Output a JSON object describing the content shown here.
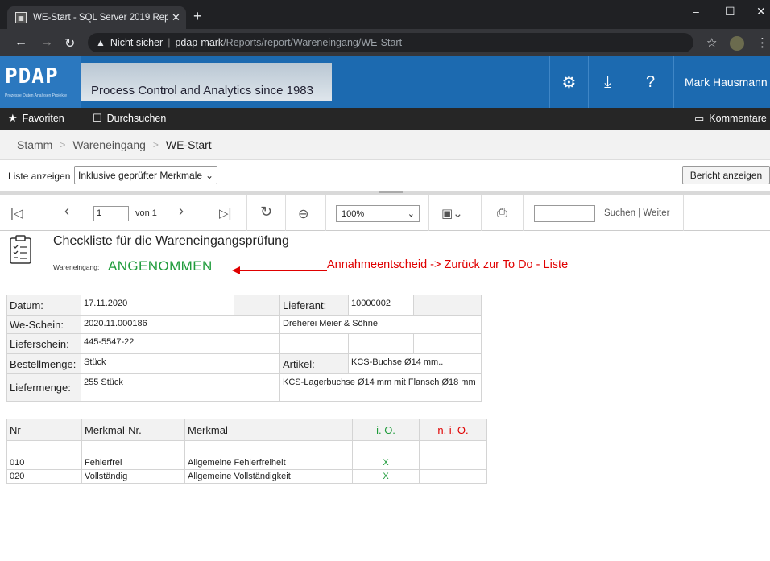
{
  "browser": {
    "tab_title": "WE-Start - SQL Server 2019 Repo",
    "tab_close": "✕",
    "new_tab": "+",
    "security": "Nicht sicher",
    "host": "pdap-mark",
    "path": "/Reports/report/Wareneingang/WE-Start"
  },
  "header": {
    "logo": "PDAP",
    "logo_sub": "Prozesse Daten Analysen Projekte",
    "tagline": "Process Control and Analytics since 1983",
    "user": "Mark Hausmann"
  },
  "toolbar": {
    "favorites": "Favoriten",
    "browse": "Durchsuchen",
    "comments": "Kommentare"
  },
  "breadcrumb": [
    "Stamm",
    "Wareneingang",
    "WE-Start"
  ],
  "params": {
    "label": "Liste anzeigen",
    "select_value": "Inklusive geprüfter Merkmale",
    "view_report": "Bericht anzeigen"
  },
  "report_toolbar": {
    "page": "1",
    "of_label": "von 1",
    "zoom": "100%",
    "search": "Suchen",
    "next": "| Weiter"
  },
  "report": {
    "title": "Checkliste für die Wareneingangsprüfung",
    "status_label": "Wareneingang:",
    "status_value": "ANGENOMMEN",
    "annotation": "Annahmeentscheid -> Zurück zur To Do - Liste",
    "info": {
      "datum_label": "Datum:",
      "datum": "17.11.2020",
      "lieferant_label": "Lieferant:",
      "lieferant_nr": "10000002",
      "we_label": "We-Schein:",
      "we": "2020.11.000186",
      "lieferant_name": "Dreherei Meier & Söhne",
      "ls_label": "Lieferschein:",
      "ls": "445-5547-22",
      "best_label": "Bestellmenge:",
      "best": "Stück",
      "artikel_label": "Artikel:",
      "artikel": "KCS-Buchse Ø14 mm..",
      "liefer_label": "Liefermenge:",
      "liefer": "255 Stück",
      "artikel_desc": "KCS-Lagerbuchse Ø14 mm mit Flansch Ø18 mm"
    },
    "items_header": [
      "Nr",
      "Merkmal-Nr.",
      "Merkmal",
      "i. O.",
      "n. i. O."
    ],
    "items": [
      {
        "nr": "010",
        "merkmal_nr": "Fehlerfrei",
        "merkmal": "Allgemeine Fehlerfreiheit",
        "io": "X",
        "nio": ""
      },
      {
        "nr": "020",
        "merkmal_nr": "Vollständig",
        "merkmal": "Allgemeine Vollständigkeit",
        "io": "X",
        "nio": ""
      }
    ]
  }
}
